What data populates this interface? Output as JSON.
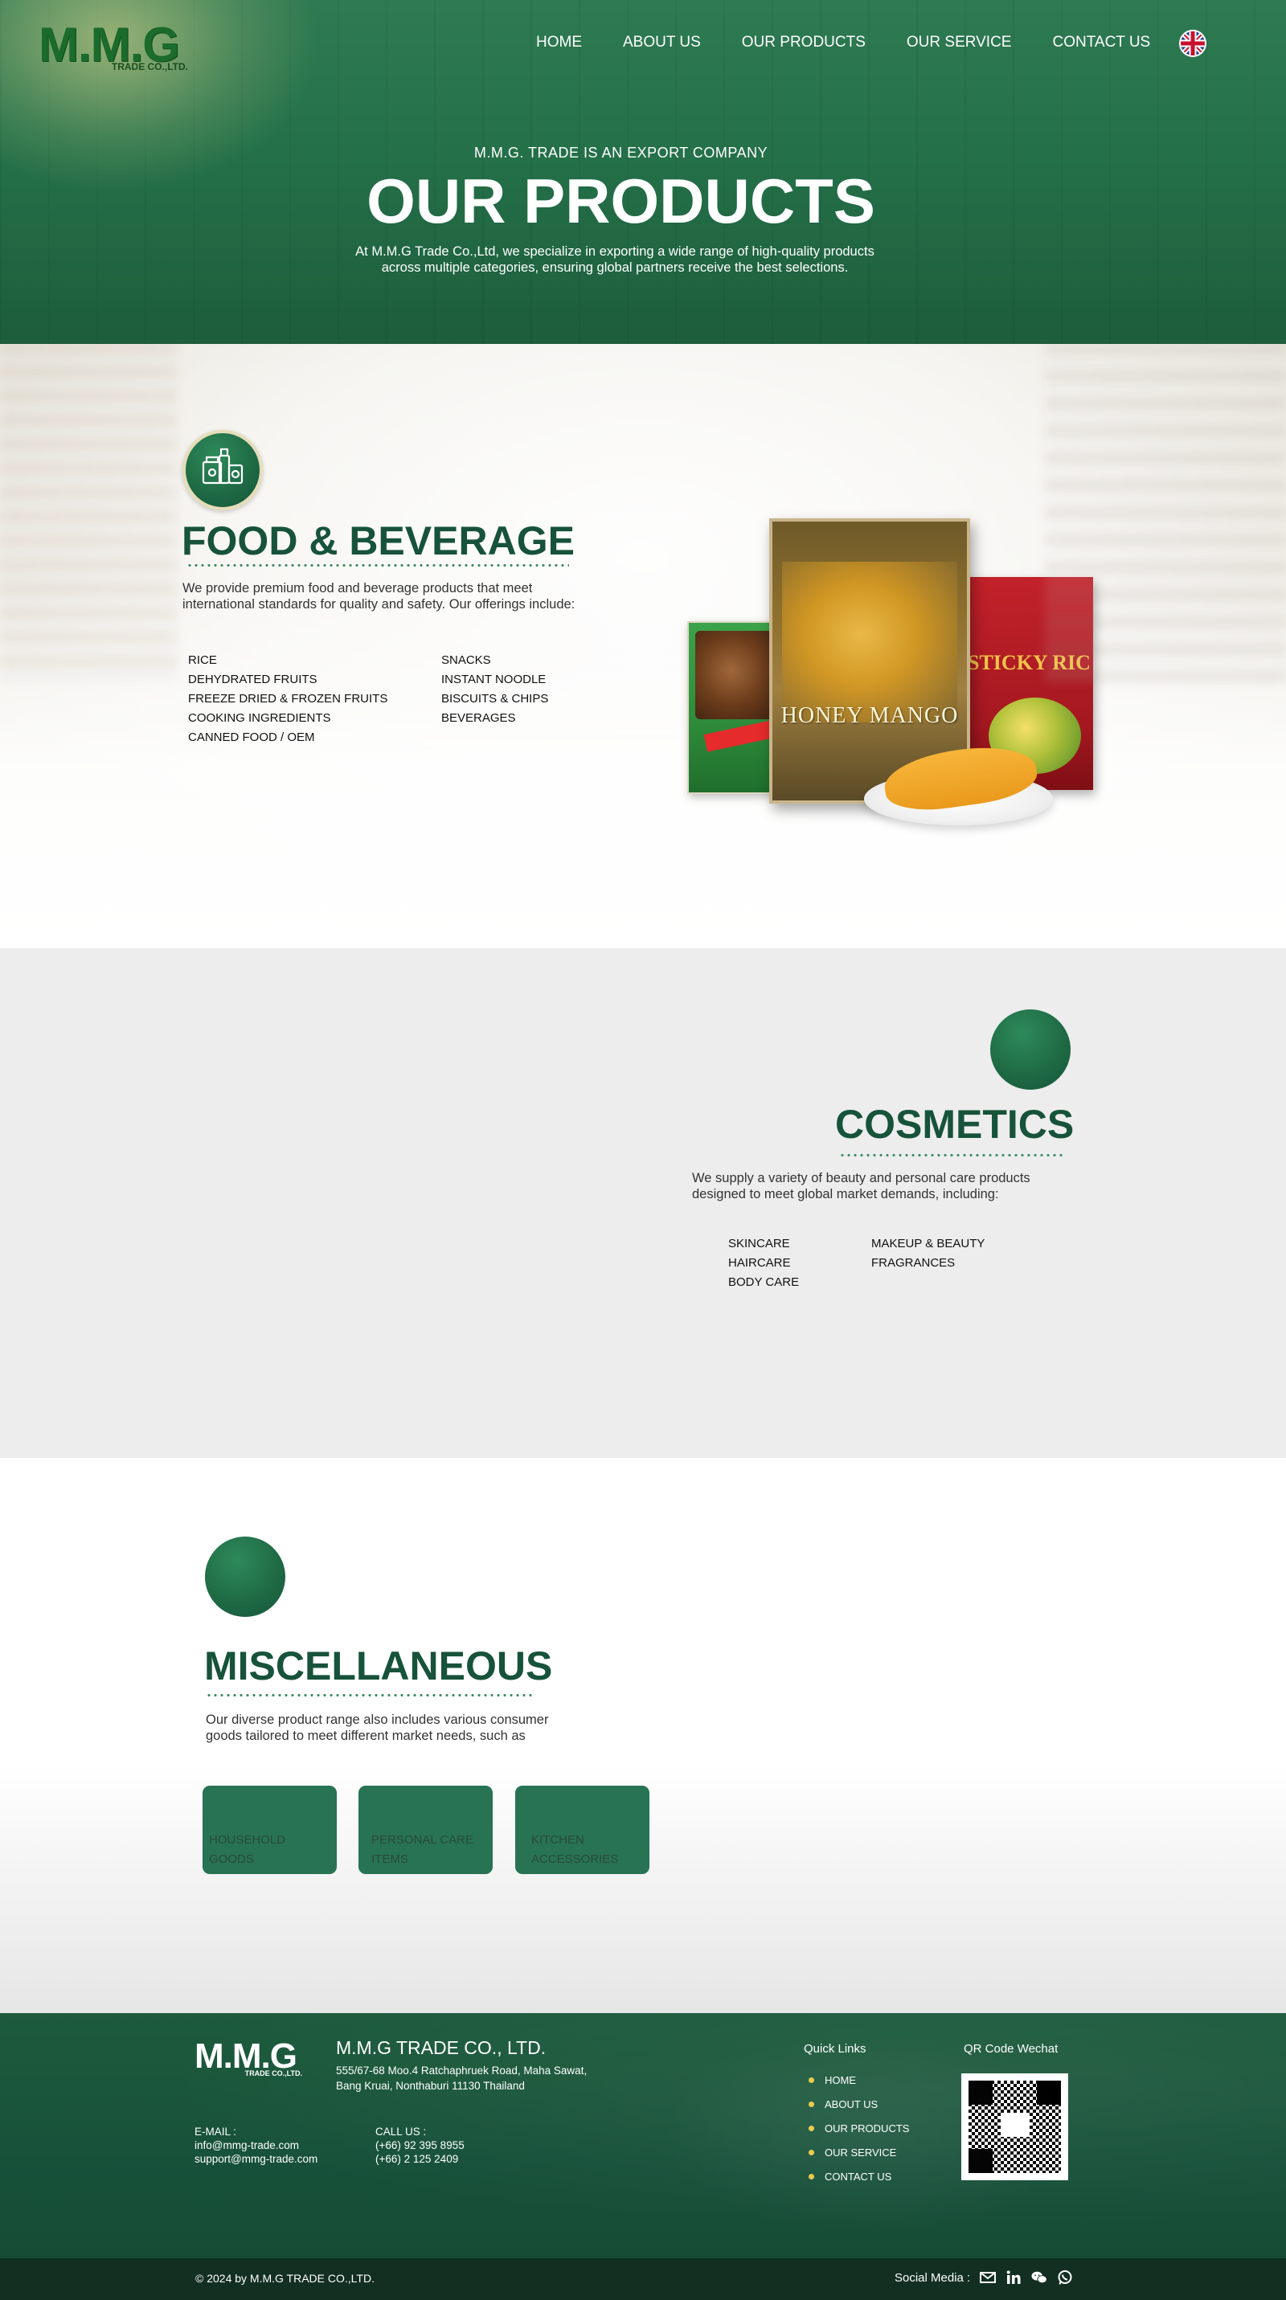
{
  "brand": {
    "logo_main": "M.M.G",
    "logo_sub": "TRADE CO.,LTD.",
    "primary_color": "#17533a",
    "accent_color": "#e8c94a"
  },
  "nav": {
    "items": [
      "HOME",
      "ABOUT US",
      "OUR PRODUCTS",
      "OUR SERVICE",
      "CONTACT US"
    ],
    "language_icon": "uk-flag-icon"
  },
  "hero": {
    "kicker": "M.M.G. TRADE IS AN EXPORT COMPANY",
    "title": "OUR PRODUCTS",
    "description_line1": "At M.M.G Trade Co.,Ltd, we specialize in exporting a wide range of high-quality products",
    "description_line2": "across multiple categories, ensuring global partners receive the best selections."
  },
  "food": {
    "title": "FOOD & BEVERAGE",
    "description_line1": "We provide premium food and beverage products that meet",
    "description_line2": "international standards for quality and safety. Our offerings include:",
    "col1": [
      "RICE",
      "DEHYDRATED FRUITS",
      "FREEZE DRIED & FROZEN FRUITS",
      "COOKING INGREDIENTS",
      "CANNED FOOD / OEM"
    ],
    "col2": [
      "SNACKS",
      "INSTANT NOODLE",
      "BISCUITS & CHIPS",
      "BEVERAGES"
    ],
    "product_names": {
      "main": "HONEY MANGO",
      "side": "STICKY RIC"
    }
  },
  "cosmetics": {
    "title": "COSMETICS",
    "description_line1": "We supply a variety of beauty and personal care products",
    "description_line2": "designed to meet global market demands, including:",
    "col1": [
      "SKINCARE",
      "HAIRCARE",
      "BODY CARE"
    ],
    "col2": [
      "MAKEUP & BEAUTY",
      "FRAGRANCES"
    ]
  },
  "misc": {
    "title": "MISCELLANEOUS",
    "description_line1": "Our diverse product range also includes various consumer",
    "description_line2": "goods tailored to meet different market needs, such as",
    "cards": [
      {
        "line1": "HOUSEHOLD",
        "line2": "GOODS"
      },
      {
        "line1": "PERSONAL CARE",
        "line2": "ITEMS"
      },
      {
        "line1": "KITCHEN",
        "line2": "ACCESSORIES"
      }
    ]
  },
  "footer": {
    "logo_main": "M.M.G",
    "logo_sub": "TRADE CO.,LTD.",
    "company": "M.M.G TRADE CO., LTD.",
    "address_line1": "555/67-68 Moo.4 Ratchaphruek Road, Maha Sawat,",
    "address_line2": "Bang Kruai, Nonthaburi  11130 Thailand",
    "email_label": "E-MAIL :",
    "emails": [
      "info@mmg-trade.com",
      "support@mmg-trade.com"
    ],
    "call_label": "CALL US :",
    "phones": [
      "(+66) 92 395 8955",
      "(+66) 2 125 2409"
    ],
    "quick_links_title": "Quick Links",
    "quick_links": [
      "HOME",
      "ABOUT US",
      "OUR PRODUCTS",
      "OUR SERVICE",
      "CONTACT US"
    ],
    "qr_title": "QR Code Wechat",
    "copyright": "© 2024 by M.M.G TRADE CO.,LTD.",
    "social_label": "Social Media :",
    "social_icons": [
      "email-icon",
      "linkedin-icon",
      "wechat-icon",
      "whatsapp-icon"
    ]
  }
}
